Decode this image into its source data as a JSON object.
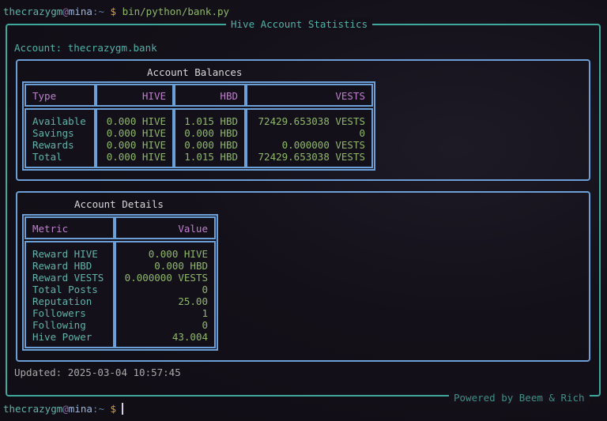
{
  "prompt_top": {
    "user": "thecrazygm",
    "at": "@",
    "host": "mina",
    "sep": ":",
    "path": "~",
    "dollar": "$",
    "command": "bin/python/bank.py"
  },
  "app": {
    "title": "Hive Account Statistics",
    "account_line": "Account: thecrazygm.bank",
    "footer": "Powered by Beem & Rich",
    "updated": "Updated: 2025-03-04 10:57:45"
  },
  "balances": {
    "title": "Account Balances",
    "headers": [
      "Type",
      "HIVE",
      "HBD",
      "VESTS"
    ],
    "rows": [
      [
        "Available",
        "0.000 HIVE",
        "1.015 HBD",
        "72429.653038 VESTS"
      ],
      [
        "Savings",
        "0.000 HIVE",
        "0.000 HBD",
        "0"
      ],
      [
        "Rewards",
        "0.000 HIVE",
        "0.000 HBD",
        "0.000000 VESTS"
      ],
      [
        "Total",
        "0.000 HIVE",
        "1.015 HBD",
        "72429.653038 VESTS"
      ]
    ]
  },
  "details": {
    "title": "Account Details",
    "headers": [
      "Metric",
      "Value"
    ],
    "rows": [
      [
        "Reward HIVE",
        "0.000 HIVE"
      ],
      [
        "Reward HBD",
        "0.000 HBD"
      ],
      [
        "Reward VESTS",
        "0.000000 VESTS"
      ],
      [
        "Total Posts",
        "0"
      ],
      [
        "Reputation",
        "25.00"
      ],
      [
        "Followers",
        "1"
      ],
      [
        "Following",
        "0"
      ],
      [
        "Hive Power",
        "43.004"
      ]
    ]
  },
  "prompt_bottom": {
    "user": "thecrazygm",
    "at": "@",
    "host": "mina",
    "sep": ":",
    "path": "~",
    "dollar": "$"
  }
}
